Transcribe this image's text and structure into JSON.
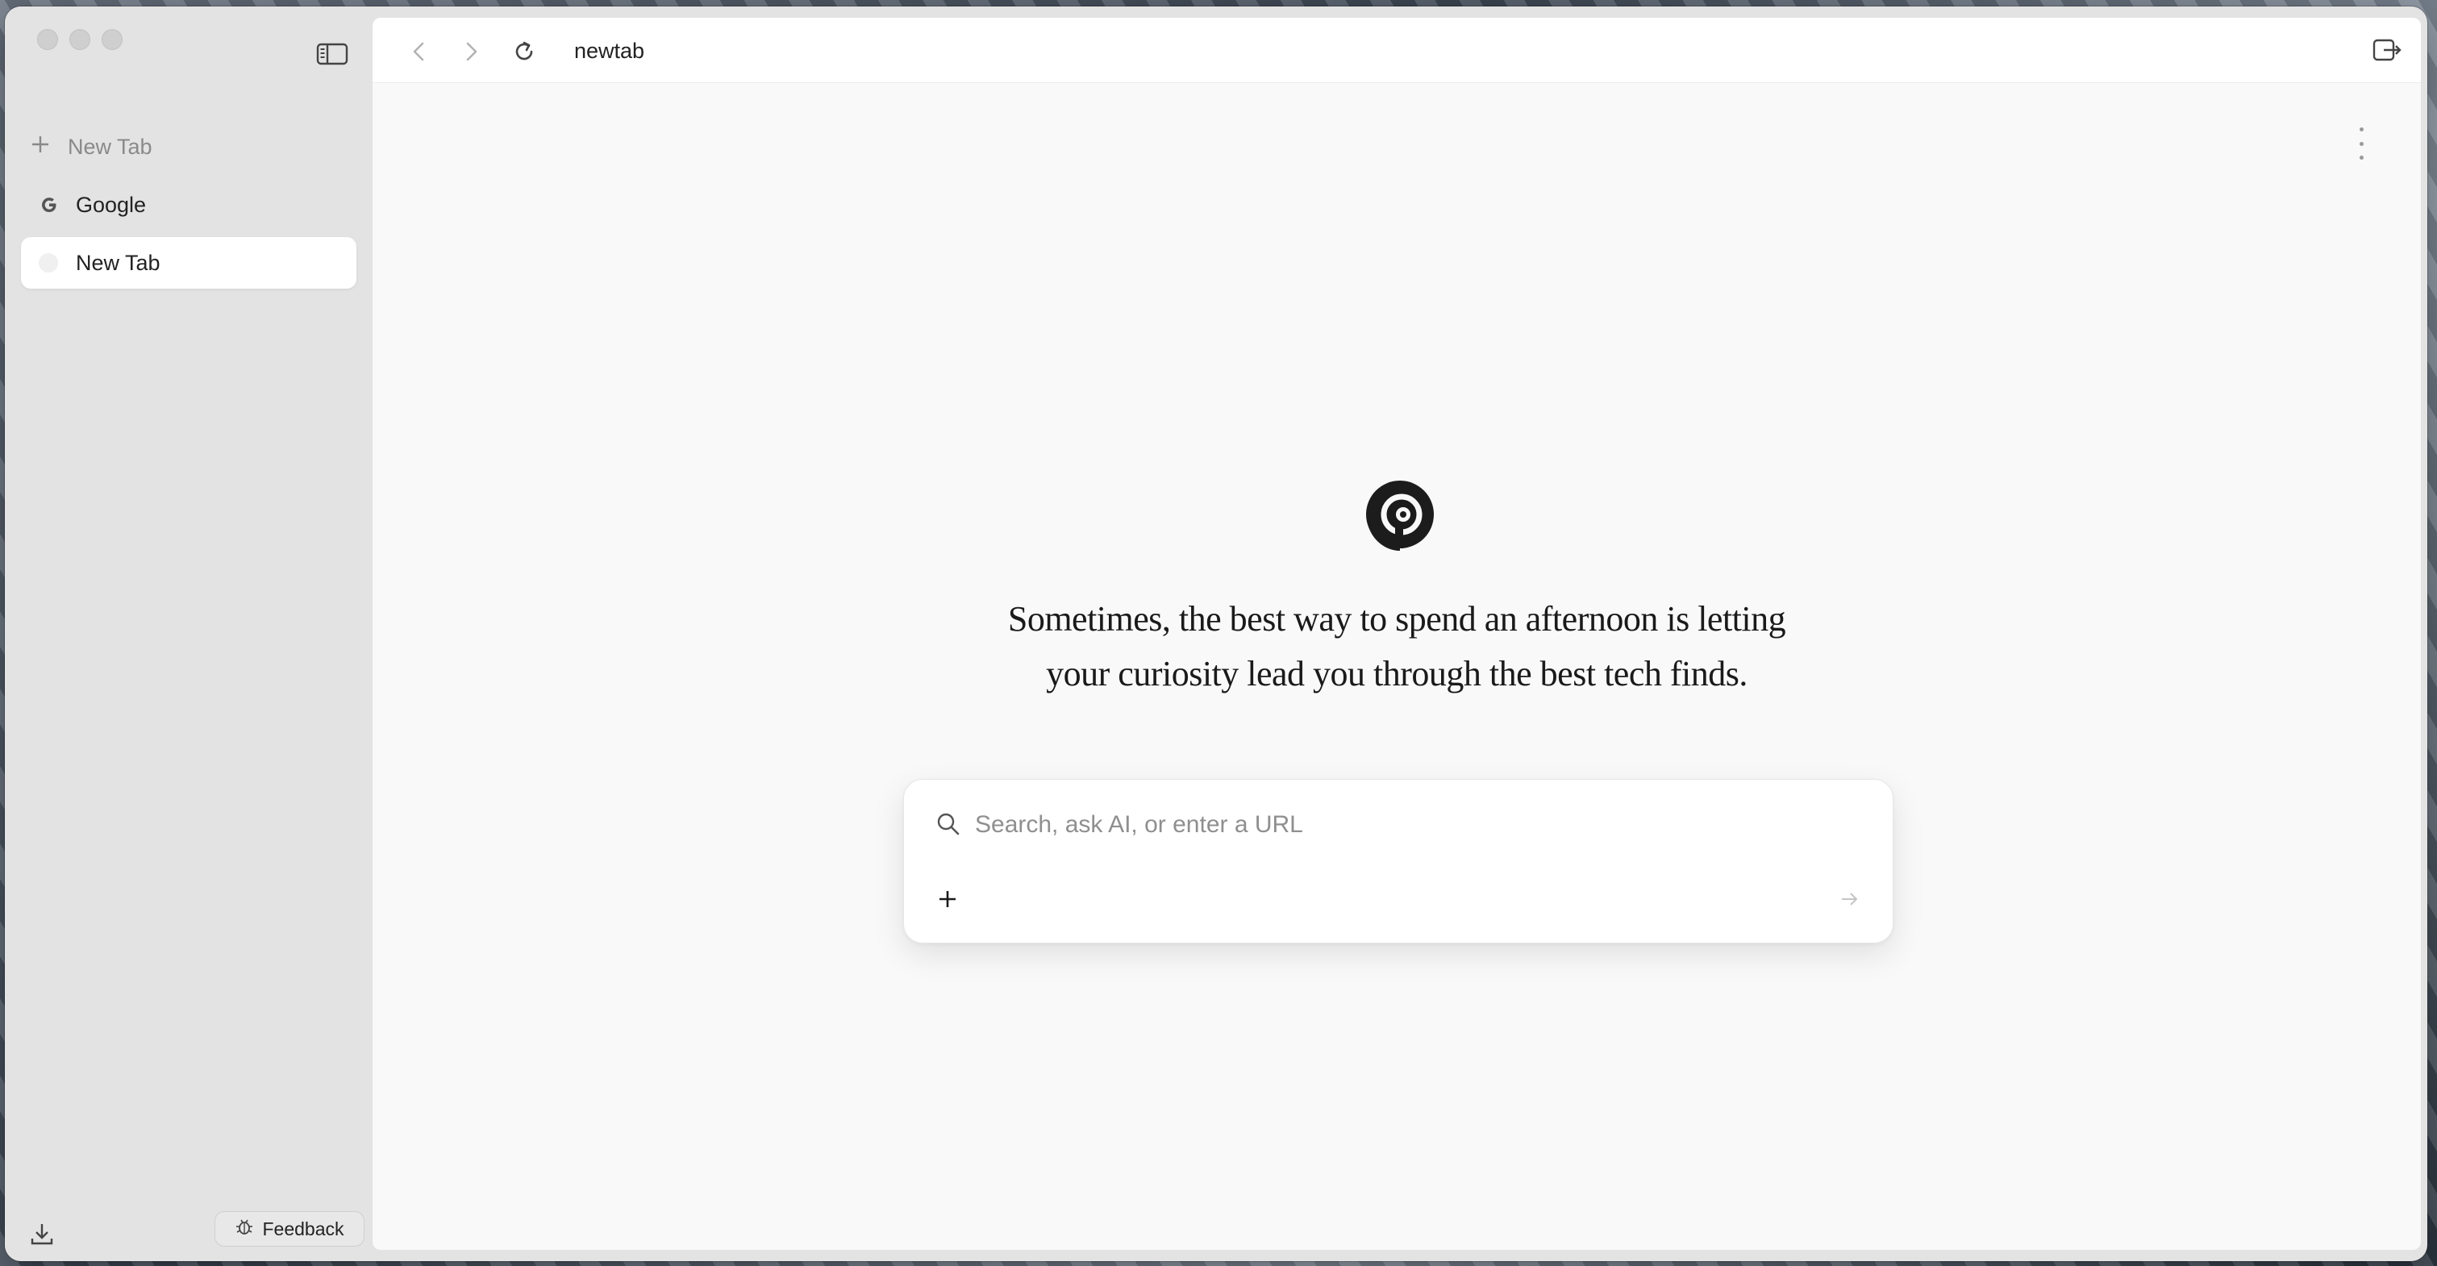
{
  "url": {
    "text": "newtab"
  },
  "sidebar": {
    "new_tab_label": "New Tab",
    "tabs": [
      {
        "label": "Google",
        "favicon": "google-g-icon"
      },
      {
        "label": "New Tab",
        "favicon": "blank-favicon",
        "active": true
      }
    ],
    "feedback_label": "Feedback"
  },
  "main": {
    "tagline_line1": "Sometimes, the best way to spend an afternoon is letting",
    "tagline_line2": "your curiosity lead you through the best tech finds.",
    "search": {
      "placeholder": "Search, ask AI, or enter a URL",
      "value": ""
    }
  },
  "icons": {
    "sidebar_toggle": "sidebar-toggle-icon",
    "back": "chevron-left-icon",
    "forward": "chevron-right-icon",
    "reload": "reload-icon",
    "toolbar_right": "panel-exit-icon",
    "menu": "kebab-menu-icon",
    "logo": "spiral-logo",
    "search": "search-icon",
    "attach": "plus-icon",
    "submit": "arrow-right-icon",
    "download": "download-icon",
    "feedback": "bug-icon"
  },
  "colors": {
    "sidebar_bg": "#e3e3e3",
    "content_bg": "#f9f9f9",
    "active_tab_bg": "#ffffff",
    "text_primary": "#222222",
    "text_muted": "#8a8a8a"
  }
}
